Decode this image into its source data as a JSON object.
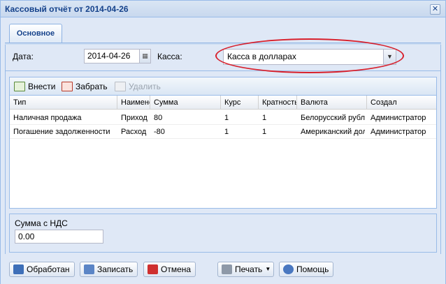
{
  "window": {
    "title": "Кассовый отчёт от 2014-04-26",
    "close_glyph": "✕"
  },
  "tabs": [
    {
      "label": "Основное"
    }
  ],
  "form": {
    "date_label": "Дата:",
    "date_value": "2014-04-26",
    "kassa_label": "Касса:",
    "kassa_value": "Касса в долларах",
    "calendar_icon": "calendar-icon",
    "dropdown_icon": "chevron-down-icon"
  },
  "toolbar": {
    "add_label": "Внести",
    "take_label": "Забрать",
    "delete_label": "Удалить"
  },
  "grid": {
    "columns": [
      "Тип",
      "Наименование",
      "Сумма",
      "Курс",
      "Кратность",
      "Валюта",
      "Создал"
    ],
    "rows": [
      [
        "Наличная продажа",
        "Приход",
        "80",
        "1",
        "1",
        "Белорусский рубль",
        "Администратор"
      ],
      [
        "Погашение задолженности",
        "Расход",
        "-80",
        "1",
        "1",
        "Американский доллар",
        "Администратор"
      ]
    ]
  },
  "summary": {
    "label": "Сумма с НДС",
    "value": "0.00"
  },
  "footer": {
    "process_label": "Обработан",
    "save_label": "Записать",
    "cancel_label": "Отмена",
    "print_label": "Печать",
    "help_label": "Помощь"
  },
  "colors": {
    "title_text": "#15428b",
    "window_bg": "#dfe8f6",
    "border": "#99bbe8",
    "highlight": "#d8202c"
  }
}
